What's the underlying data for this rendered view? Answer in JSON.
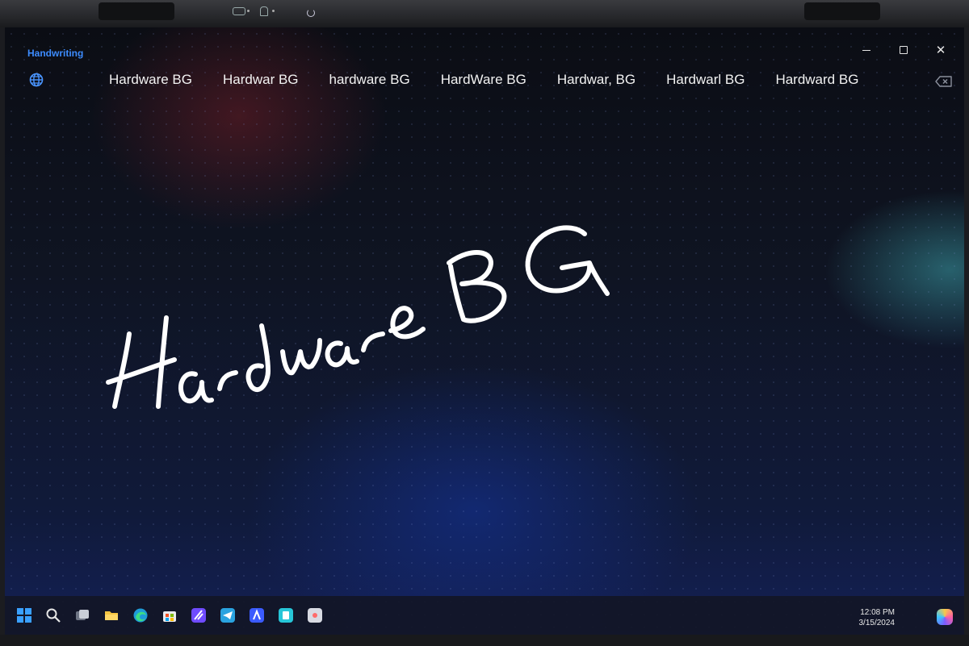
{
  "app": {
    "title": "Handwriting"
  },
  "candidates": [
    "Hardware BG",
    "Hardwar BG",
    "hardware BG",
    "HardWare BG",
    "Hardwar, BG",
    "Hardwarl BG",
    "Hardward BG"
  ],
  "handwritten_text": "Hardware BG",
  "icons": {
    "language": "globe-icon",
    "delete": "backspace-icon",
    "minimize": "minimize-icon",
    "maximize": "maximize-icon",
    "close": "close-icon"
  },
  "taskbar": {
    "apps": [
      "start-icon",
      "search-icon",
      "task-view-icon",
      "file-explorer-icon",
      "edge-icon",
      "store-icon",
      "app-icon",
      "telegram-icon",
      "app-icon",
      "app-icon",
      "app-icon"
    ],
    "time": "12:08 PM",
    "date": "3/15/2024"
  },
  "colors": {
    "accent": "#3d8cff",
    "ink": "#ffffff"
  }
}
